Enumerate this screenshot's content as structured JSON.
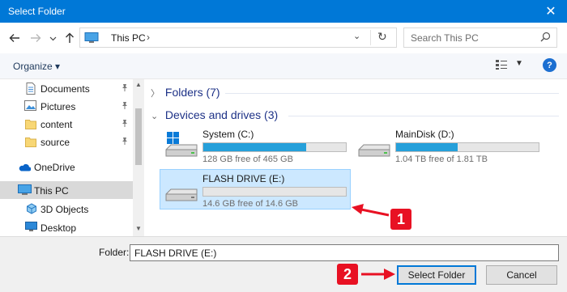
{
  "window": {
    "title": "Select Folder",
    "close_label": "✕"
  },
  "navigation": {
    "back_icon": "arrow-left-icon",
    "forward_icon": "arrow-right-icon",
    "recent_icon": "chevron-down-icon",
    "up_icon": "arrow-up-icon",
    "address": {
      "location": "This PC",
      "separator": "›",
      "dropdown": "⌄",
      "refresh": "↻"
    },
    "search": {
      "placeholder": "Search This PC"
    }
  },
  "command_bar": {
    "organize_label": "Organize ▾",
    "view_dropdown": "▼",
    "help_label": "?"
  },
  "sidebar": {
    "items": [
      {
        "label": "Documents",
        "icon": "document-icon",
        "pinned": true
      },
      {
        "label": "Pictures",
        "icon": "picture-icon",
        "pinned": true
      },
      {
        "label": "content",
        "icon": "folder-icon",
        "pinned": true
      },
      {
        "label": "source",
        "icon": "folder-icon",
        "pinned": true
      },
      {
        "label": "OneDrive",
        "icon": "cloud-icon",
        "pinned": false
      },
      {
        "label": "This PC",
        "icon": "pc-icon",
        "pinned": false,
        "selected": true
      },
      {
        "label": "3D Objects",
        "icon": "cube-icon",
        "pinned": false
      },
      {
        "label": "Desktop",
        "icon": "desktop-icon",
        "pinned": false
      }
    ],
    "pin_glyph": "📌"
  },
  "content": {
    "groups": [
      {
        "label": "Folders (7)",
        "expanded": false,
        "chevron": "〉"
      },
      {
        "label": "Devices and drives (3)",
        "expanded": true,
        "chevron": "⌄"
      }
    ],
    "drives": [
      {
        "name": "System (C:)",
        "free_text": "128 GB free of 465 GB",
        "used_fraction": 0.72,
        "icon": "windows-drive-icon",
        "selected": false
      },
      {
        "name": "MainDisk (D:)",
        "free_text": "1.04 TB free of 1.81 TB",
        "used_fraction": 0.43,
        "icon": "hard-drive-icon",
        "selected": false
      },
      {
        "name": "FLASH DRIVE (E:)",
        "free_text": "14.6 GB free of 14.6 GB",
        "used_fraction": 0.0,
        "icon": "usb-drive-icon",
        "selected": true
      }
    ]
  },
  "annotations": {
    "marker_1": "1",
    "marker_2": "2",
    "color": "#e81123"
  },
  "footer": {
    "folder_label": "Folder:",
    "folder_value": "FLASH DRIVE (E:)",
    "select_button": "Select Folder",
    "cancel_button": "Cancel"
  },
  "colors": {
    "titlebar": "#0078d7",
    "progress": "#26a0da",
    "selection": "#cce8ff"
  }
}
